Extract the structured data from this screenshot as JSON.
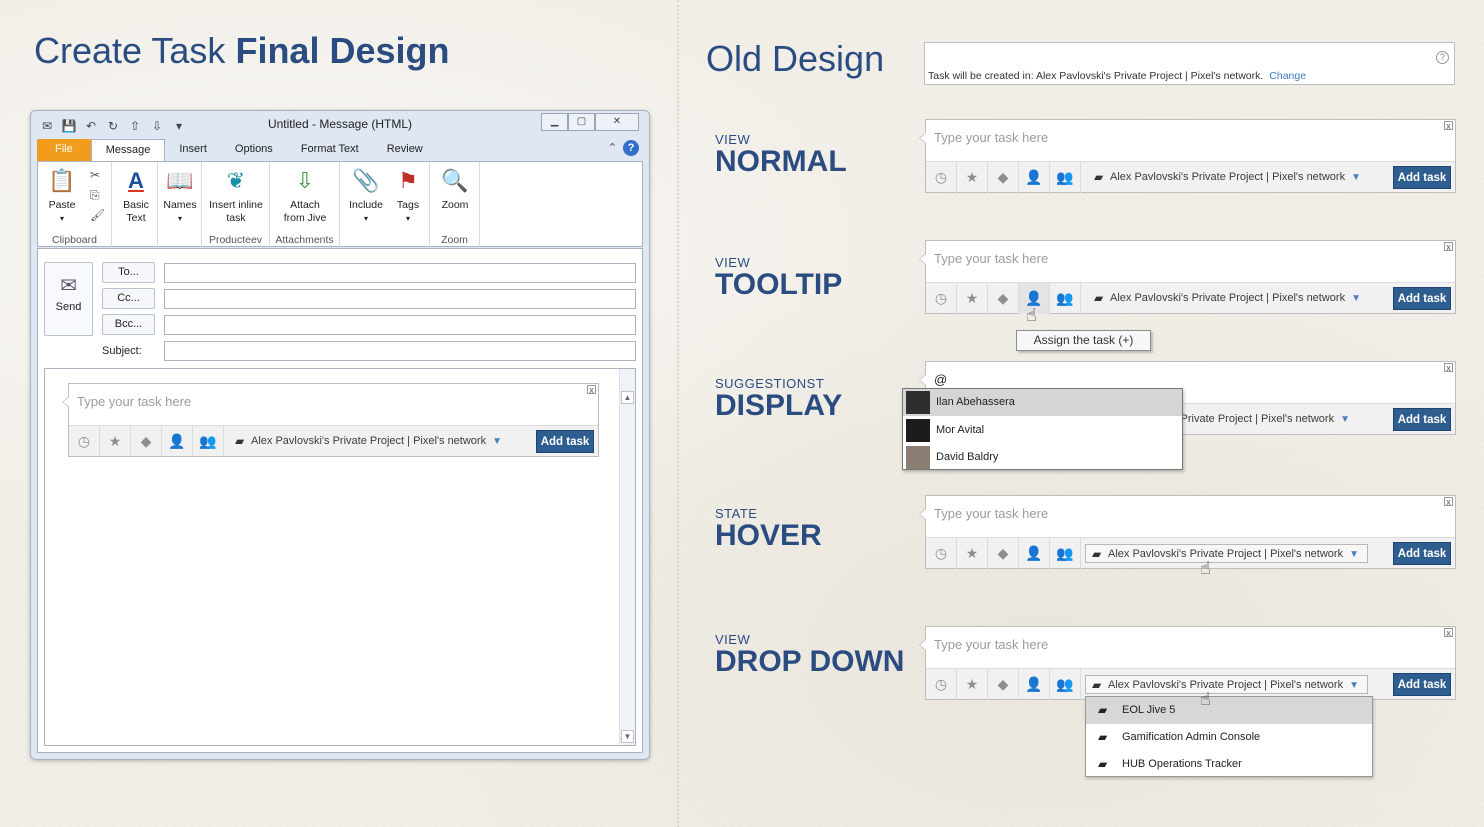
{
  "titles": {
    "main_light": "Create Task",
    "main_bold": "Final Design",
    "old": "Old Design"
  },
  "outlook": {
    "window_title": "Untitled  -  Message (HTML)",
    "tabs": [
      "File",
      "Message",
      "Insert",
      "Options",
      "Format Text",
      "Review"
    ],
    "ribbon": {
      "paste": "Paste",
      "clipboard": "Clipboard",
      "basic_text": "Basic Text",
      "names": "Names",
      "insert_inline_task": "Insert inline task",
      "producteev": "Producteev",
      "attach_from_jive": "Attach from Jive",
      "attachments": "Attachments",
      "include": "Include",
      "tags": "Tags",
      "zoom": "Zoom",
      "zoom_group": "Zoom"
    },
    "send": "Send",
    "to": "To...",
    "cc": "Cc...",
    "bcc": "Bcc...",
    "subject": "Subject:"
  },
  "task": {
    "placeholder": "Type your task here",
    "project": "Alex Pavlovski's Private Project | Pixel's network",
    "add_label": "Add task",
    "close": "x"
  },
  "old_design": {
    "info": "Task will be created in: Alex Pavlovski's Private Project | Pixel's network.",
    "change": "Change",
    "help": "?"
  },
  "sections": [
    {
      "small": "VIEW",
      "big": "NORMAL"
    },
    {
      "small": "VIEW",
      "big": "TOOLTIP"
    },
    {
      "small": "SUGGESTIONST",
      "big": "DISPLAY"
    },
    {
      "small": "STATE",
      "big": "HOVER"
    },
    {
      "small": "VIEW",
      "big": "DROP DOWN"
    }
  ],
  "tooltip": "Assign the task (+)",
  "suggest_input": "@",
  "suggestions": [
    "Ilan Abehassera",
    "Mor Avital",
    "David Baldry"
  ],
  "partial_project": "s Private Project | Pixel's network",
  "dropdown_items": [
    "EOL Jive 5",
    "Gamification Admin Console",
    "HUB Operations Tracker"
  ],
  "colors": {
    "accent": "#2a4c80",
    "add_button": "#2e5d8f",
    "file_tab": "#f29c1d"
  }
}
